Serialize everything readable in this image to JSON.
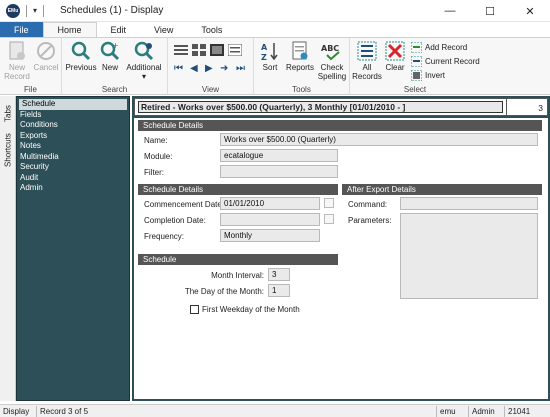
{
  "window": {
    "title": "Schedules (1) - Display",
    "app_icon_text": "EMu",
    "minimize": "—",
    "maximize": "☐",
    "close": "✕"
  },
  "ribbon_tabs": [
    "File",
    "Home",
    "Edit",
    "View",
    "Tools"
  ],
  "ribbon": {
    "file_group": {
      "label": "File",
      "new_record": "New Record",
      "cancel": "Cancel"
    },
    "search_group": {
      "label": "Search",
      "previous": "Previous",
      "new": "New",
      "additional": "Additional"
    },
    "view_group": {
      "label": "View"
    },
    "tools_group": {
      "label": "Tools",
      "sort": "Sort",
      "reports": "Reports",
      "check_spelling": "Check Spelling"
    },
    "select_group": {
      "label": "Select",
      "all_records": "All Records",
      "clear": "Clear",
      "add_record": "Add Record",
      "current_record": "Current Record",
      "invert": "Invert"
    }
  },
  "side_tabs": [
    "Tabs",
    "Shortcuts"
  ],
  "nav_items": [
    "Schedule",
    "Fields",
    "Conditions",
    "Exports",
    "Notes",
    "Multimedia",
    "Security",
    "Audit",
    "Admin"
  ],
  "record_header": {
    "title": "Retired - Works over $500.00 (Quarterly), 3 Monthly [01/01/2010 - ]",
    "count": "3"
  },
  "schedule_details_top": {
    "section": "Schedule Details",
    "name_label": "Name:",
    "name_value": "Works over $500.00 (Quarterly)",
    "module_label": "Module:",
    "module_value": "ecatalogue",
    "filter_label": "Filter:",
    "filter_value": ""
  },
  "schedule_details": {
    "section": "Schedule Details",
    "commencement_label": "Commencement Date:",
    "commencement_value": "01/01/2010",
    "completion_label": "Completion Date:",
    "completion_value": "",
    "frequency_label": "Frequency:",
    "frequency_value": "Monthly"
  },
  "after_export": {
    "section": "After Export Details",
    "command_label": "Command:",
    "command_value": "",
    "parameters_label": "Parameters:",
    "parameters_value": ""
  },
  "schedule": {
    "section": "Schedule",
    "month_interval_label": "Month Interval:",
    "month_interval_value": "3",
    "day_of_month_label": "The Day of the Month:",
    "day_of_month_value": "1",
    "first_weekday_label": "First Weekday of the Month"
  },
  "statusbar": {
    "mode": "Display",
    "record": "Record 3 of 5",
    "user": "emu",
    "role": "Admin",
    "id": "21041"
  },
  "colors": {
    "file_tab": "#2b6cb0",
    "panel": "#2d4f57",
    "section": "#555555"
  }
}
